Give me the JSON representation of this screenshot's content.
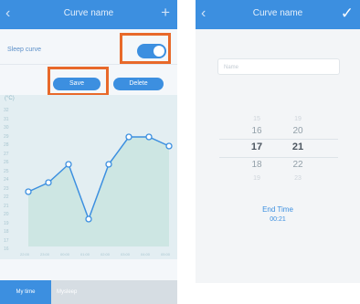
{
  "left_screen": {
    "title": "Curve name",
    "back_icon": "chevron-left-icon",
    "add_icon": "plus-icon",
    "sleep_curve_label": "Sleep curve",
    "sleep_curve_enabled": true,
    "save_label": "Save",
    "delete_label": "Delete",
    "unit_label": "(°C)",
    "y_ticks": [
      "32",
      "31",
      "30",
      "29",
      "28",
      "27",
      "26",
      "25",
      "24",
      "23",
      "22",
      "21",
      "20",
      "19",
      "18",
      "17",
      "16"
    ],
    "x_ticks": [
      "22:00",
      "23:00",
      "00:00",
      "01:00",
      "02:00",
      "03:00",
      "04:00",
      "05:00"
    ],
    "tabs": [
      "My time",
      "Mysleep"
    ],
    "accent_color": "#3c8fe0",
    "highlight_color": "#e8692a"
  },
  "chart_data": {
    "type": "line",
    "ylim": [
      16,
      32
    ],
    "x": [
      "22:00",
      "23:00",
      "00:00",
      "01:00",
      "02:00",
      "03:00",
      "04:00",
      "05:00"
    ],
    "values": [
      22,
      23,
      25,
      19,
      25,
      28,
      28,
      27
    ]
  },
  "right_screen": {
    "title": "Curve name",
    "confirm_icon": "checkmark-icon",
    "name_placeholder": "Name",
    "hour_column": [
      "15",
      "16",
      "17",
      "18",
      "19"
    ],
    "minute_column": [
      "19",
      "20",
      "21",
      "22",
      "23"
    ],
    "end_time_label": "End Time",
    "end_time_value": "00:21"
  }
}
